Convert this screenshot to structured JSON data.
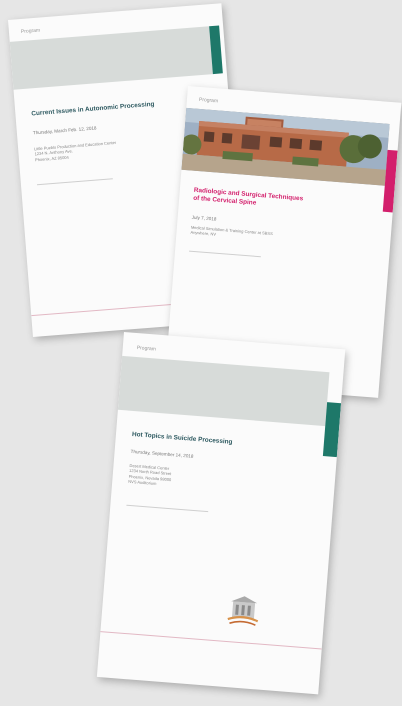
{
  "cards": [
    {
      "label": "Program",
      "title": "Current Issues in Autonomic Processing",
      "date": "Thursday, March Feb. 12, 2018",
      "address": "Little Pueblo Production and Education Center\n1234 N. Anthony Ave.\nPhoenix, AZ 85004",
      "accent": "#1e7869"
    },
    {
      "label": "Program",
      "title": "Radiologic and Surgical Techniques\nof the Cervical Spine",
      "date": "July 7, 2018",
      "address": "Medical Simulation & Training Center at SBSS\nAnywhere, NV",
      "accent": "#d31f6c"
    },
    {
      "label": "Program",
      "title": "Hot Topics in Suicide Processing",
      "date": "Thursday, September 14, 2018",
      "address": "Desert Medical Center\n1234 North Road Street\nPhoenix, Nevada 98000\nNVS Auditorium",
      "accent": "#1e7869"
    }
  ]
}
